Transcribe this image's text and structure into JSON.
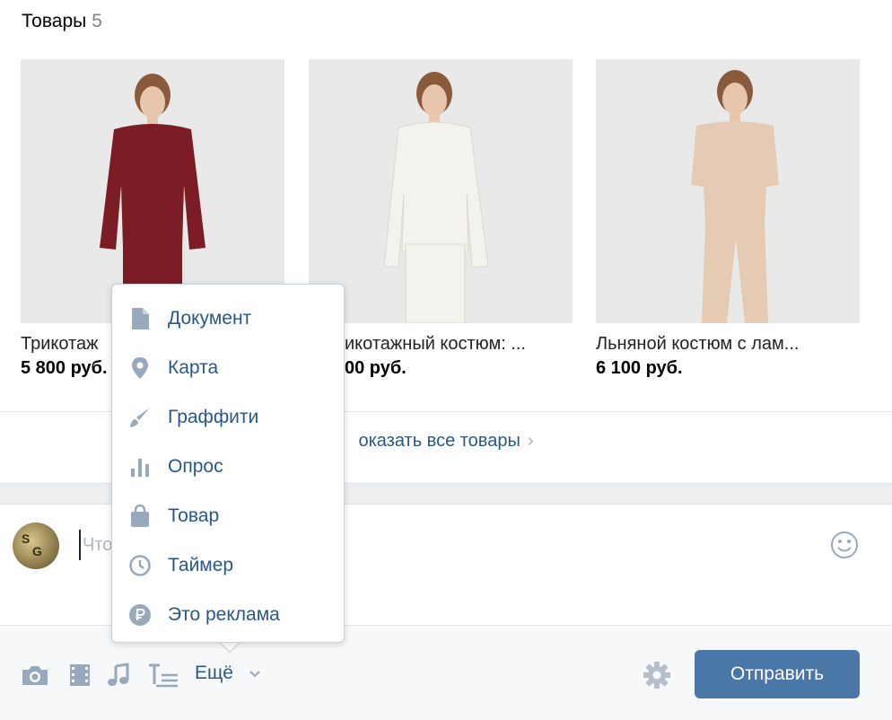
{
  "goods": {
    "title": "Товары",
    "count": "5",
    "items": [
      {
        "name": "Трикотаж",
        "price": "5 800 руб.",
        "color": "#7c1c24"
      },
      {
        "name": "икотажный костюм: ...",
        "price": "00 руб.",
        "color": "#f1efe9"
      },
      {
        "name": "Льняной костюм с лам...",
        "price": "6 100 руб.",
        "color": "#e6cbb4"
      }
    ],
    "show_all": "оказать все товары"
  },
  "composer": {
    "placeholder": "Что"
  },
  "toolbar": {
    "more_label": "Ещё",
    "send_label": "Отправить"
  },
  "menu": {
    "items": [
      {
        "label": "Документ",
        "icon": "document-icon"
      },
      {
        "label": "Карта",
        "icon": "map-pin-icon"
      },
      {
        "label": "Граффити",
        "icon": "brush-icon"
      },
      {
        "label": "Опрос",
        "icon": "poll-icon"
      },
      {
        "label": "Товар",
        "icon": "shopping-bag-icon"
      },
      {
        "label": "Таймер",
        "icon": "clock-icon"
      },
      {
        "label": "Это реклама",
        "icon": "ruble-icon"
      }
    ]
  },
  "colors": {
    "link": "#2a5885",
    "icon": "#99a9bc",
    "button": "#4a76a8"
  }
}
